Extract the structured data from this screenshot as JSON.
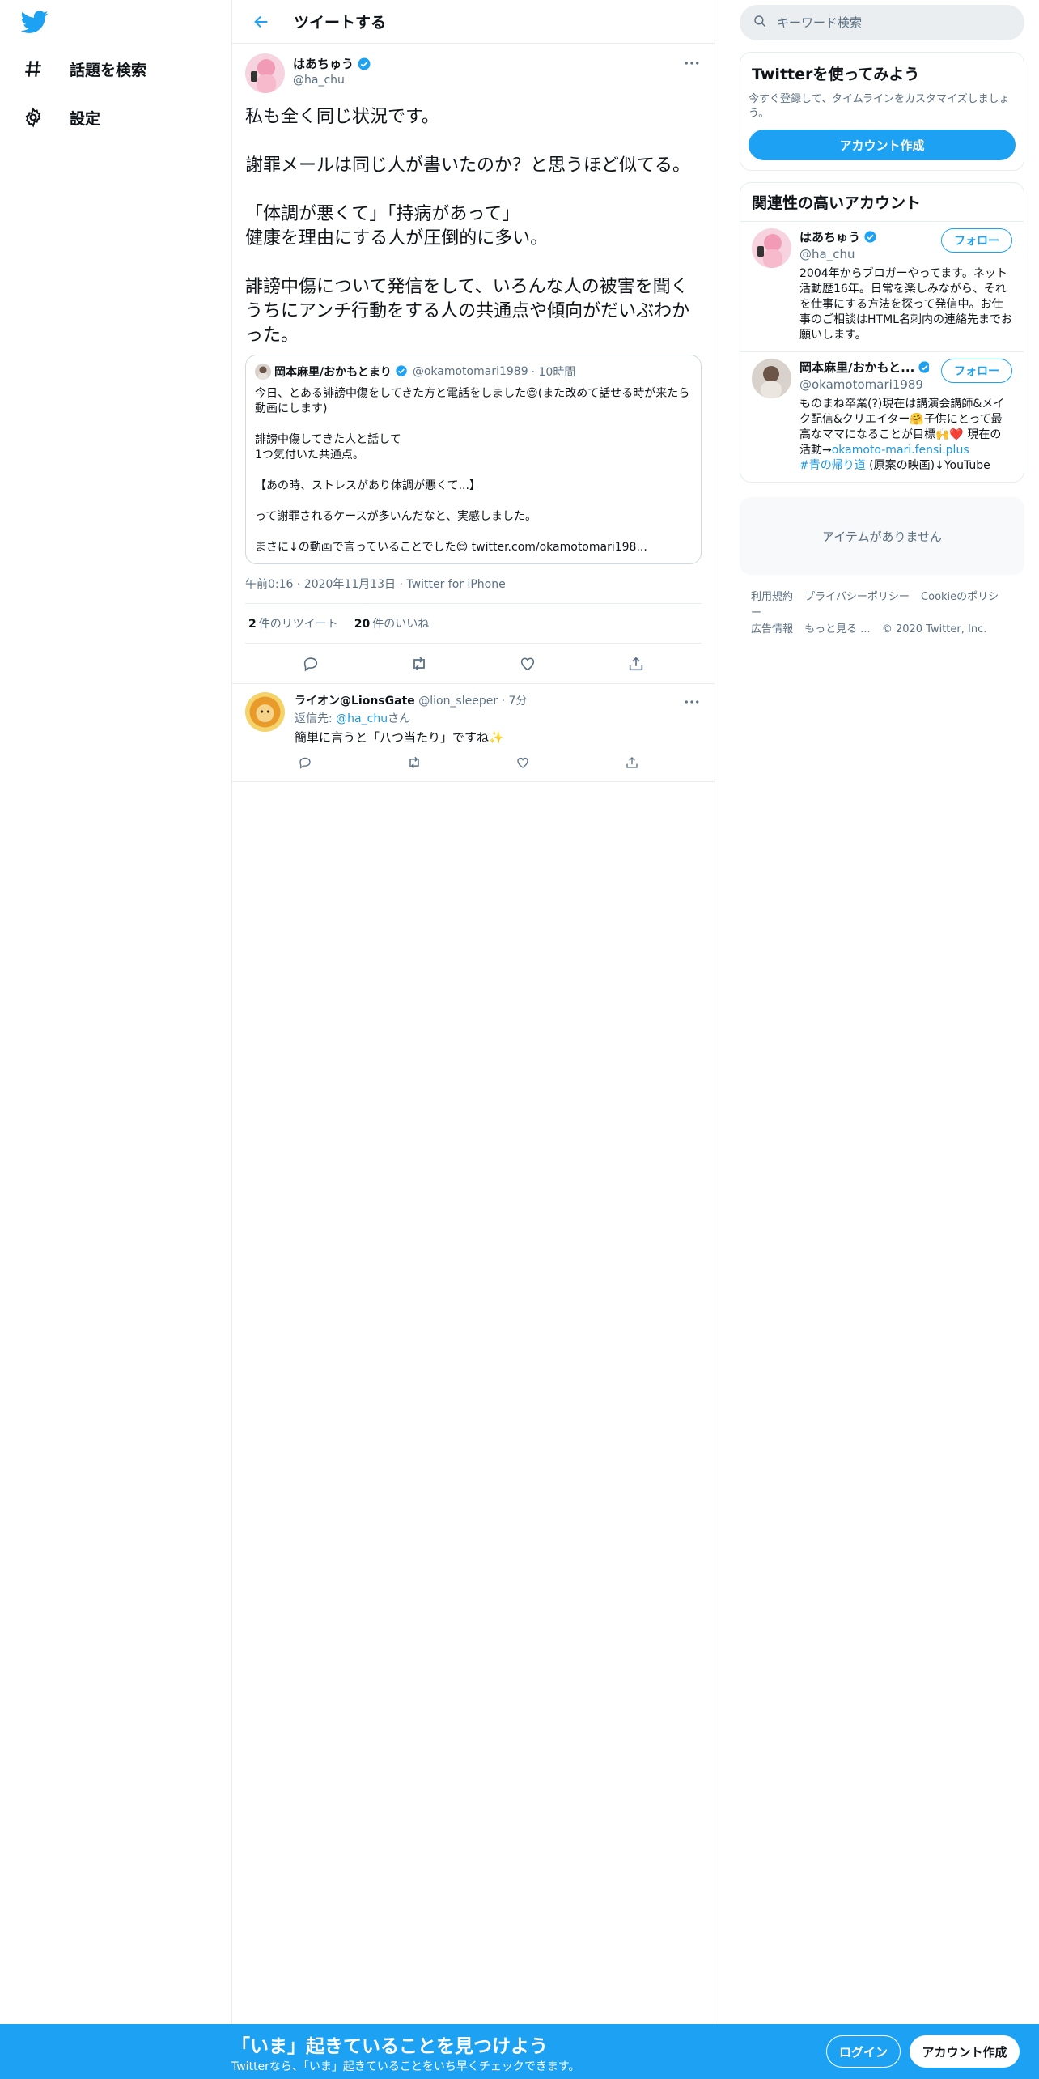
{
  "nav": {
    "items": [
      {
        "label": "話題を検索",
        "icon": "hashtag-icon"
      },
      {
        "label": "設定",
        "icon": "gear-icon"
      }
    ]
  },
  "header": {
    "title": "ツイートする"
  },
  "tweet": {
    "name": "はあちゅう",
    "handle": "@ha_chu",
    "text": "私も全く同じ状況です。\n\n謝罪メールは同じ人が書いたのか？と思うほど似てる。\n\n「体調が悪くて」「持病があって」\n健康を理由にする人が圧倒的に多い。\n\n誹謗中傷について発信をして、いろんな人の被害を聞くうちにアンチ行動をする人の共通点や傾向がだいぶわかった。",
    "quote": {
      "name": "岡本麻里/おかもとまり",
      "handle": "@okamotomari1989",
      "time": "· 10時間",
      "text": "今日、とある誹謗中傷をしてきた方と電話をしました😌(また改めて話せる時が来たら動画にします)\n\n誹謗中傷してきた人と話して\n1つ気付いた共通点。\n\n【あの時、ストレスがあり体調が悪くて...】\n\nって謝罪されるケースが多いんだなと、実感しました。\n\nまさに↓の動画で言っていることでした😌 twitter.com/okamotomari198..."
    },
    "timestamp": "午前0:16 · 2020年11月13日 · Twitter for iPhone",
    "retweets": "2",
    "retweets_label": "件のリツイート",
    "likes": "20",
    "likes_label": "件のいいね"
  },
  "reply": {
    "name": "ライオン@LionsGate",
    "handle": "@lion_sleeper",
    "time": "· 7分",
    "reply_to_prefix": "返信先: ",
    "reply_to_handle": "@ha_chu",
    "reply_to_suffix": "さん",
    "text": "簡単に言うと「八つ当たり」ですね✨"
  },
  "search": {
    "placeholder": "キーワード検索"
  },
  "signup_card": {
    "title": "Twitterを使ってみよう",
    "subtitle": "今すぐ登録して、タイムラインをカスタマイズしましょう。",
    "button": "アカウント作成"
  },
  "related": {
    "title": "関連性の高いアカウント",
    "follow_label": "フォロー",
    "accounts": [
      {
        "name": "はあちゅう",
        "handle": "@ha_chu",
        "bio": "2004年からブロガーやってます。ネット活動歴16年。日常を楽しみながら、それを仕事にする方法を探って発信中。お仕事のご相談はHTML名刺内の連絡先までお願いします。"
      },
      {
        "name": "岡本麻里/おかもと...",
        "handle": "@okamotomari1989",
        "bio": "ものまね卒業(?)現在は講演会講師&メイク配信&クリエイター🤗子供にとって最高なママになることが目標🙌❤️ 現在の活動→",
        "bio_link": "okamoto-mari.fensi.plus",
        "bio_tag": "#青の帰り道",
        "bio_end": " (原案の映画)↓YouTube"
      }
    ]
  },
  "empty": {
    "text": "アイテムがありません"
  },
  "footer": {
    "links": [
      "利用規約",
      "プライバシーポリシー",
      "Cookieのポリシー",
      "広告情報",
      "もっと見る ...",
      "© 2020 Twitter, Inc."
    ]
  },
  "bottom_bar": {
    "title": "「いま」起きていることを見つけよう",
    "subtitle": "Twitterなら、「いま」起きていることをいち早くチェックできます。",
    "login": "ログイン",
    "signup": "アカウント作成"
  },
  "colors": {
    "accent": "#1da1f2",
    "link": "#1b95e0",
    "muted": "#5b7083",
    "border": "#e6ecf0"
  }
}
